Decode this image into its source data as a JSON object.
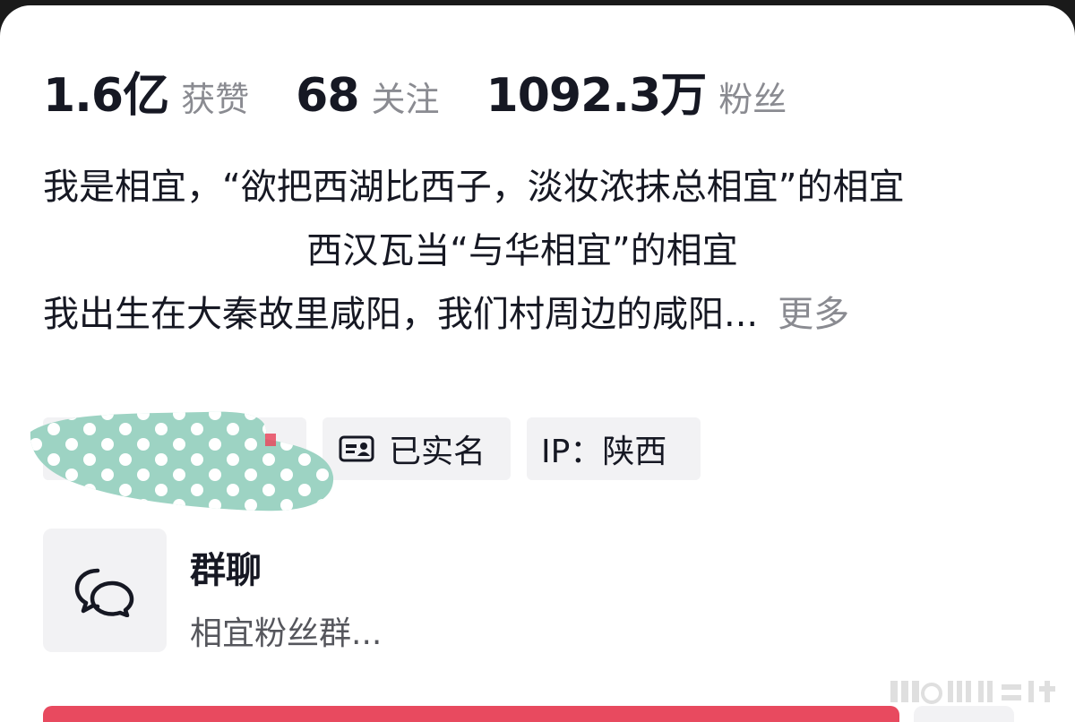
{
  "stats": [
    {
      "value": "1.6亿",
      "label": "获赞"
    },
    {
      "value": "68",
      "label": "关注"
    },
    {
      "value": "1092.3万",
      "label": "粉丝"
    }
  ],
  "bio": {
    "line1": "我是相宜，“欲把西湖比西子，淡妆浓抹总相宜”的相宜",
    "line2": "西汉瓦当“与华相宜”的相宜",
    "line3": "我出生在大秦故里咸阳，我们村周边的咸阳...",
    "more_label": "更多"
  },
  "tags": {
    "verified_label": "已实名",
    "ip_label": "IP：陕西"
  },
  "group": {
    "title": "群聊",
    "subtitle": "相宜粉丝群..."
  },
  "icons": {
    "id_card": "id-card-icon",
    "chat": "chat-bubbles-icon"
  },
  "colors": {
    "primary_text": "#161823",
    "secondary_text": "#8a8b91",
    "tag_bg": "#f2f2f4",
    "follow_button": "#e84a5f",
    "redaction": "#9dd3c3"
  }
}
